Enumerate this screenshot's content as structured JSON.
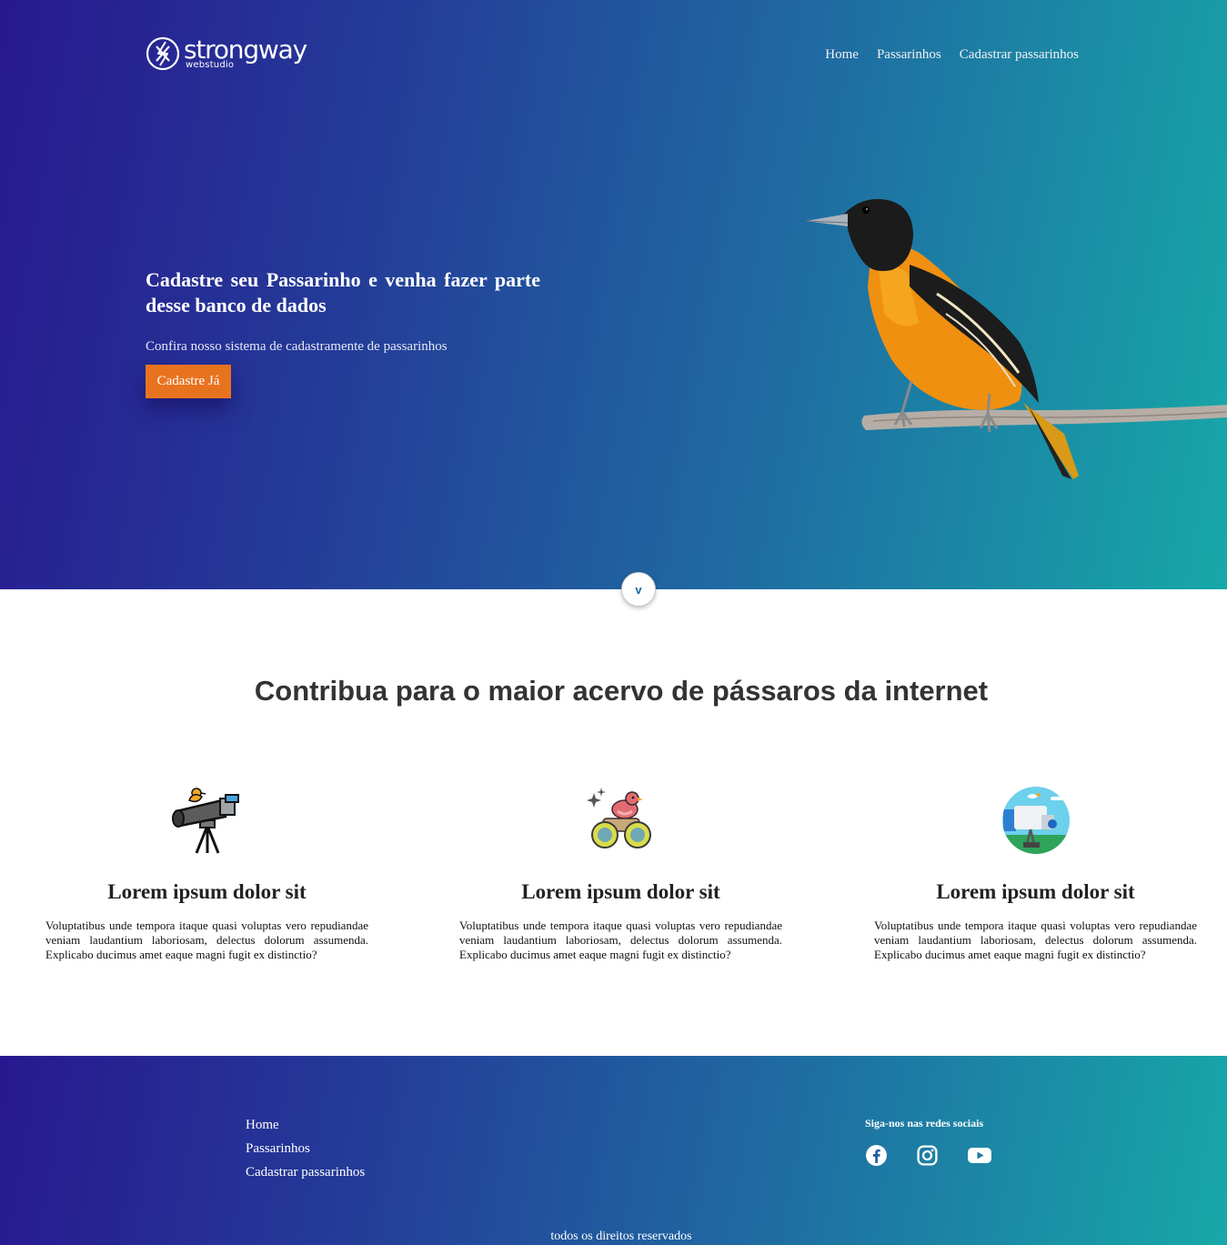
{
  "brand": {
    "name": "strongway",
    "tagline": "webstudio"
  },
  "nav": {
    "items": [
      {
        "label": "Home"
      },
      {
        "label": "Passarinhos"
      },
      {
        "label": "Cadastrar passarinhos"
      }
    ]
  },
  "hero": {
    "title": "Cadastre seu Passarinho e venha fazer parte desse banco de dados",
    "subtitle": "Confira nosso sistema de cadastramente de passarinhos",
    "cta_label": "Cadastre Já",
    "scroll_icon": "chevron-down-icon",
    "scroll_label": "v"
  },
  "section": {
    "title": "Contribua para o maior acervo de pássaros da internet",
    "features": [
      {
        "icon": "telescope-icon",
        "title": "Lorem ipsum dolor sit",
        "text": "Voluptatibus unde tempora itaque quasi voluptas vero repudiandae veniam laudantium laboriosam, delectus dolorum assumenda. Explicabo ducimus amet eaque magni fugit ex distinctio?"
      },
      {
        "icon": "binoculars-bird-icon",
        "title": "Lorem ipsum dolor sit",
        "text": "Voluptatibus unde tempora itaque quasi voluptas vero repudiandae veniam laudantium laboriosam, delectus dolorum assumenda. Explicabo ducimus amet eaque magni fugit ex distinctio?"
      },
      {
        "icon": "birdwatching-scene-icon",
        "title": "Lorem ipsum dolor sit",
        "text": "Voluptatibus unde tempora itaque quasi voluptas vero repudiandae veniam laudantium laboriosam, delectus dolorum assumenda. Explicabo ducimus amet eaque magni fugit ex distinctio?"
      }
    ]
  },
  "footer": {
    "nav": [
      {
        "label": "Home"
      },
      {
        "label": "Passarinhos"
      },
      {
        "label": "Cadastrar passarinhos"
      }
    ],
    "social_title": "Siga-nos nas redes sociais",
    "social": [
      {
        "icon": "facebook-icon"
      },
      {
        "icon": "instagram-icon"
      },
      {
        "icon": "youtube-icon"
      }
    ],
    "rights": "todos os direitos reservados"
  },
  "colors": {
    "gradient_start": "#281890",
    "gradient_end": "#17a8a8",
    "cta": "#e8731f",
    "heading": "#333333"
  }
}
